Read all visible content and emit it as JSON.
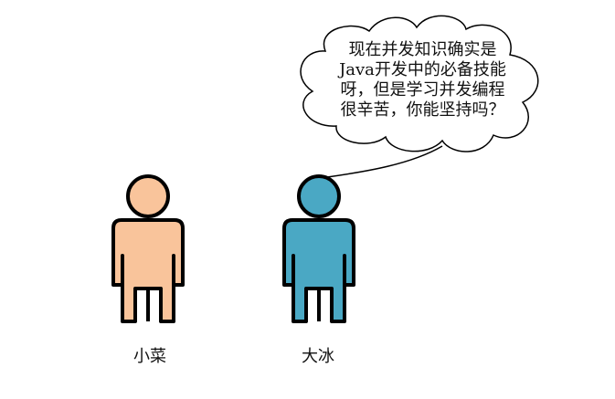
{
  "speech_bubble": {
    "lines": [
      "现在并发知识确实是",
      "Java开发中的必备技能",
      "呀，但是学习并发编程",
      "很辛苦，你能坚持吗？"
    ]
  },
  "characters": [
    {
      "name": "小菜",
      "color": "#F9C49B"
    },
    {
      "name": "大冰",
      "color": "#4AA8C4"
    }
  ],
  "colors": {
    "outline": "#000000",
    "background": "#FFFFFF"
  }
}
